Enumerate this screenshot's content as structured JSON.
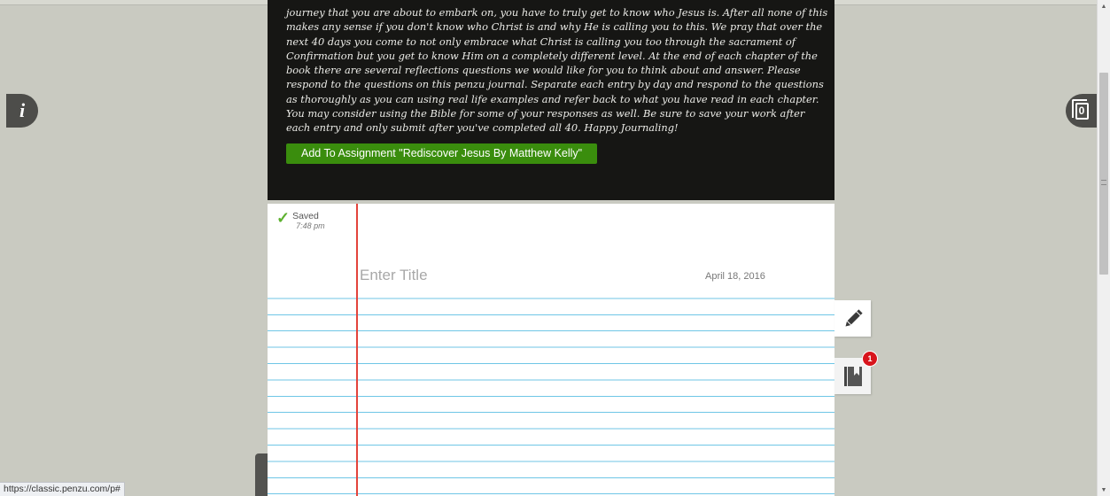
{
  "banner": {
    "text": "journey that you are about to embark on, you have to truly get to know who Jesus is. After all none of this makes any sense if you don't know who Christ is and why He is calling you to this. We pray that over the next 40 days you come to not only embrace what Christ is calling you too through the sacrament of Confirmation but you get to know Him on a completely different level. At the end of each chapter of the book there are several reflections questions we would like for you to think about and answer. Please respond to the questions on this penzu journal. Separate each entry by day and respond to the questions as thoroughly as you can using real life examples and refer back to what you have read in each chapter. You may consider using the Bible for some of your responses as well. Be sure to save your work after each entry and only submit after you've completed all 40. Happy Journaling!",
    "assign_button": "Add To Assignment \"Rediscover Jesus By Matthew Kelly\""
  },
  "entry": {
    "saved_label": "Saved",
    "saved_time": "7:48 pm",
    "title_placeholder": "Enter Title",
    "title_value": "",
    "date": "April 18, 2016"
  },
  "sidebar_right": {
    "pages_count": "0",
    "notebook_badge": "1"
  },
  "status_bar": {
    "url": "https://classic.penzu.com/p#"
  },
  "colors": {
    "accent_green": "#3a8d0d",
    "margin_red": "#e3433b",
    "rule_blue": "#6fc6e6",
    "badge_red": "#d8141c"
  },
  "icons": {
    "info": "info-icon",
    "pages": "pages-icon",
    "edit": "pencil-icon",
    "notebook": "book-icon",
    "saved": "check-icon"
  }
}
